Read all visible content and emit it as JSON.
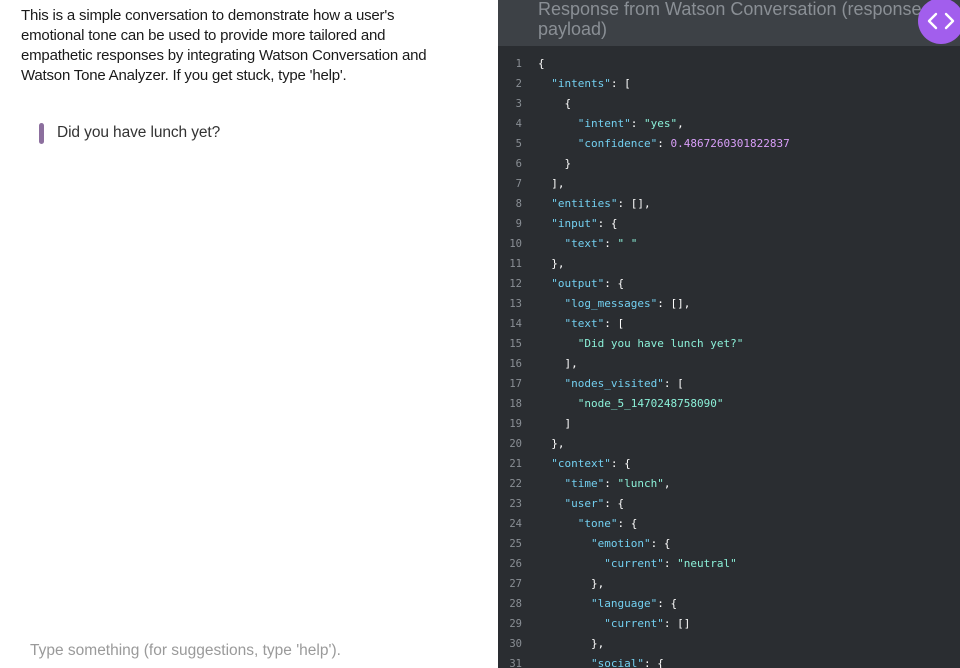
{
  "chat": {
    "intro": "This is a simple conversation to demonstrate how a user's emotional tone can be used to provide more tailored and empathetic responses by integrating Watson Conversation and Watson Tone Analyzer. If you get stuck, type 'help'.",
    "messages": [
      {
        "from": "watson",
        "text": "Did you have lunch yet?"
      }
    ],
    "input_placeholder": "Type something (for suggestions, type 'help')."
  },
  "payload": {
    "title": "Response from Watson Conversation (response payload)",
    "toggle_icon": "code-brackets-icon",
    "colors": {
      "key": "#73d0f0",
      "string": "#8bf0d8",
      "number": "#d99ff9",
      "toggle": "#a25eed"
    },
    "lines": [
      [
        {
          "t": "p",
          "v": "{"
        }
      ],
      [
        {
          "t": "p",
          "v": "  "
        },
        {
          "t": "k",
          "v": "\"intents\""
        },
        {
          "t": "p",
          "v": ": ["
        }
      ],
      [
        {
          "t": "p",
          "v": "    {"
        }
      ],
      [
        {
          "t": "p",
          "v": "      "
        },
        {
          "t": "k",
          "v": "\"intent\""
        },
        {
          "t": "p",
          "v": ": "
        },
        {
          "t": "s",
          "v": "\"yes\""
        },
        {
          "t": "p",
          "v": ","
        }
      ],
      [
        {
          "t": "p",
          "v": "      "
        },
        {
          "t": "k",
          "v": "\"confidence\""
        },
        {
          "t": "p",
          "v": ": "
        },
        {
          "t": "n",
          "v": "0.4867260301822837"
        }
      ],
      [
        {
          "t": "p",
          "v": "    }"
        }
      ],
      [
        {
          "t": "p",
          "v": "  ],"
        }
      ],
      [
        {
          "t": "p",
          "v": "  "
        },
        {
          "t": "k",
          "v": "\"entities\""
        },
        {
          "t": "p",
          "v": ": [],"
        }
      ],
      [
        {
          "t": "p",
          "v": "  "
        },
        {
          "t": "k",
          "v": "\"input\""
        },
        {
          "t": "p",
          "v": ": {"
        }
      ],
      [
        {
          "t": "p",
          "v": "    "
        },
        {
          "t": "k",
          "v": "\"text\""
        },
        {
          "t": "p",
          "v": ": "
        },
        {
          "t": "s",
          "v": "\" \""
        }
      ],
      [
        {
          "t": "p",
          "v": "  },"
        }
      ],
      [
        {
          "t": "p",
          "v": "  "
        },
        {
          "t": "k",
          "v": "\"output\""
        },
        {
          "t": "p",
          "v": ": {"
        }
      ],
      [
        {
          "t": "p",
          "v": "    "
        },
        {
          "t": "k",
          "v": "\"log_messages\""
        },
        {
          "t": "p",
          "v": ": [],"
        }
      ],
      [
        {
          "t": "p",
          "v": "    "
        },
        {
          "t": "k",
          "v": "\"text\""
        },
        {
          "t": "p",
          "v": ": ["
        }
      ],
      [
        {
          "t": "p",
          "v": "      "
        },
        {
          "t": "s",
          "v": "\"Did you have lunch yet?\""
        }
      ],
      [
        {
          "t": "p",
          "v": "    ],"
        }
      ],
      [
        {
          "t": "p",
          "v": "    "
        },
        {
          "t": "k",
          "v": "\"nodes_visited\""
        },
        {
          "t": "p",
          "v": ": ["
        }
      ],
      [
        {
          "t": "p",
          "v": "      "
        },
        {
          "t": "s",
          "v": "\"node_5_1470248758090\""
        }
      ],
      [
        {
          "t": "p",
          "v": "    ]"
        }
      ],
      [
        {
          "t": "p",
          "v": "  },"
        }
      ],
      [
        {
          "t": "p",
          "v": "  "
        },
        {
          "t": "k",
          "v": "\"context\""
        },
        {
          "t": "p",
          "v": ": {"
        }
      ],
      [
        {
          "t": "p",
          "v": "    "
        },
        {
          "t": "k",
          "v": "\"time\""
        },
        {
          "t": "p",
          "v": ": "
        },
        {
          "t": "s",
          "v": "\"lunch\""
        },
        {
          "t": "p",
          "v": ","
        }
      ],
      [
        {
          "t": "p",
          "v": "    "
        },
        {
          "t": "k",
          "v": "\"user\""
        },
        {
          "t": "p",
          "v": ": {"
        }
      ],
      [
        {
          "t": "p",
          "v": "      "
        },
        {
          "t": "k",
          "v": "\"tone\""
        },
        {
          "t": "p",
          "v": ": {"
        }
      ],
      [
        {
          "t": "p",
          "v": "        "
        },
        {
          "t": "k",
          "v": "\"emotion\""
        },
        {
          "t": "p",
          "v": ": {"
        }
      ],
      [
        {
          "t": "p",
          "v": "          "
        },
        {
          "t": "k",
          "v": "\"current\""
        },
        {
          "t": "p",
          "v": ": "
        },
        {
          "t": "s",
          "v": "\"neutral\""
        }
      ],
      [
        {
          "t": "p",
          "v": "        },"
        }
      ],
      [
        {
          "t": "p",
          "v": "        "
        },
        {
          "t": "k",
          "v": "\"language\""
        },
        {
          "t": "p",
          "v": ": {"
        }
      ],
      [
        {
          "t": "p",
          "v": "          "
        },
        {
          "t": "k",
          "v": "\"current\""
        },
        {
          "t": "p",
          "v": ": []"
        }
      ],
      [
        {
          "t": "p",
          "v": "        },"
        }
      ],
      [
        {
          "t": "p",
          "v": "        "
        },
        {
          "t": "k",
          "v": "\"social\""
        },
        {
          "t": "p",
          "v": ": {"
        }
      ]
    ]
  }
}
